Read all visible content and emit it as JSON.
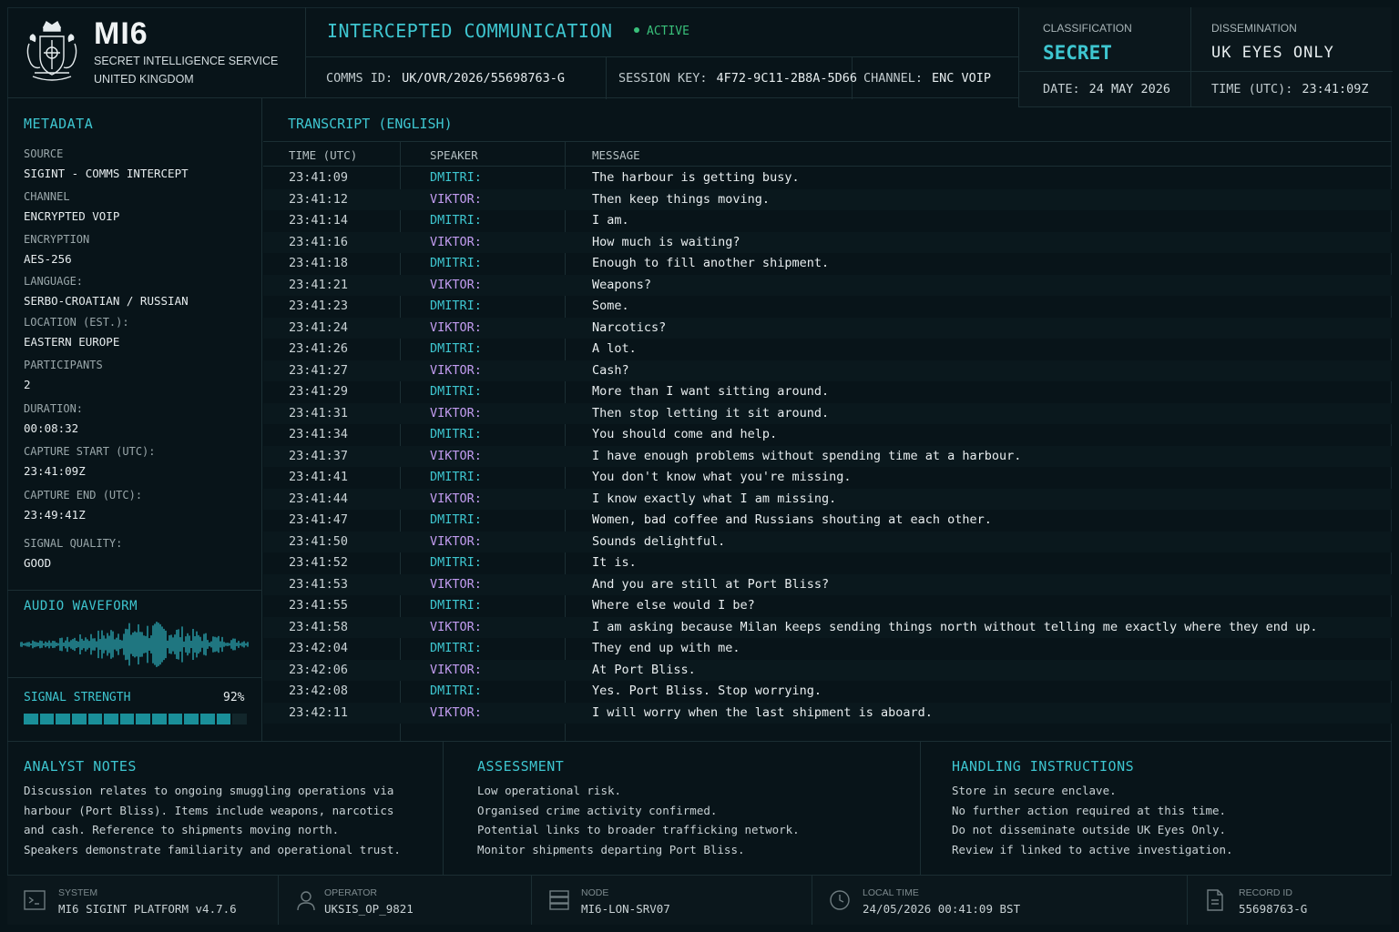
{
  "header": {
    "brand_title": "MI6",
    "brand_sub1": "SECRET INTELLIGENCE SERVICE",
    "brand_sub2": "UNITED KINGDOM",
    "comm_title": "INTERCEPTED COMMUNICATION",
    "status": "ACTIVE",
    "comms_id_label": "COMMS ID:",
    "comms_id": "UK/OVR/2026/55698763-G",
    "session_key_label": "SESSION KEY:",
    "session_key": "4F72-9C11-2B8A-5D66",
    "channel_label": "CHANNEL:",
    "channel": "ENC VOIP",
    "classification_label": "CLASSIFICATION",
    "classification": "SECRET",
    "dissemination_label": "DISSEMINATION",
    "dissemination": "UK EYES ONLY",
    "date_label": "DATE:",
    "date": "24 MAY 2026",
    "time_label": "TIME (UTC):",
    "time": "23:41:09Z"
  },
  "metadata": {
    "title": "METADATA",
    "items": [
      {
        "k": "SOURCE",
        "v": "SIGINT - COMMS INTERCEPT"
      },
      {
        "k": "CHANNEL",
        "v": "ENCRYPTED VOIP"
      },
      {
        "k": "ENCRYPTION",
        "v": "AES-256"
      },
      {
        "k": "LANGUAGE:",
        "v": "SERBO-CROATIAN / RUSSIAN"
      },
      {
        "k": "LOCATION (EST.):",
        "v": "EASTERN EUROPE"
      },
      {
        "k": "PARTICIPANTS",
        "v": "2"
      },
      {
        "k": "DURATION:",
        "v": "00:08:32"
      },
      {
        "k": "CAPTURE START (UTC):",
        "v": "23:41:09Z"
      },
      {
        "k": "CAPTURE END (UTC):",
        "v": "23:49:41Z"
      },
      {
        "k": "SIGNAL QUALITY:",
        "v": "GOOD"
      }
    ],
    "waveform_title": "AUDIO WAVEFORM",
    "signal_label": "SIGNAL STRENGTH",
    "signal_value": "92%",
    "signal_fraction": 0.92
  },
  "transcript": {
    "title": "TRANSCRIPT (ENGLISH)",
    "col_time": "TIME (UTC)",
    "col_speaker": "SPEAKER",
    "col_message": "MESSAGE",
    "rows": [
      {
        "t": "23:41:09",
        "s": "DMITRI:",
        "m": "The harbour is getting busy."
      },
      {
        "t": "23:41:12",
        "s": "VIKTOR:",
        "m": "Then keep things moving."
      },
      {
        "t": "23:41:14",
        "s": "DMITRI:",
        "m": "I am."
      },
      {
        "t": "23:41:16",
        "s": "VIKTOR:",
        "m": "How much is waiting?"
      },
      {
        "t": "23:41:18",
        "s": "DMITRI:",
        "m": "Enough to fill another shipment."
      },
      {
        "t": "23:41:21",
        "s": "VIKTOR:",
        "m": "Weapons?"
      },
      {
        "t": "23:41:23",
        "s": "DMITRI:",
        "m": "Some."
      },
      {
        "t": "23:41:24",
        "s": "VIKTOR:",
        "m": "Narcotics?"
      },
      {
        "t": "23:41:26",
        "s": "DMITRI:",
        "m": "A lot."
      },
      {
        "t": "23:41:27",
        "s": "VIKTOR:",
        "m": "Cash?"
      },
      {
        "t": "23:41:29",
        "s": "DMITRI:",
        "m": "More than I want sitting around."
      },
      {
        "t": "23:41:31",
        "s": "VIKTOR:",
        "m": "Then stop letting it sit around."
      },
      {
        "t": "23:41:34",
        "s": "DMITRI:",
        "m": "You should come and help."
      },
      {
        "t": "23:41:37",
        "s": "VIKTOR:",
        "m": "I have enough problems without spending time at a harbour."
      },
      {
        "t": "23:41:41",
        "s": "DMITRI:",
        "m": "You don't know what you're missing."
      },
      {
        "t": "23:41:44",
        "s": "VIKTOR:",
        "m": "I know exactly what I am missing."
      },
      {
        "t": "23:41:47",
        "s": "DMITRI:",
        "m": "Women, bad coffee and Russians shouting at each other."
      },
      {
        "t": "23:41:50",
        "s": "VIKTOR:",
        "m": "Sounds delightful."
      },
      {
        "t": "23:41:52",
        "s": "DMITRI:",
        "m": "It is."
      },
      {
        "t": "23:41:53",
        "s": "VIKTOR:",
        "m": "And you are still at Port Bliss?"
      },
      {
        "t": "23:41:55",
        "s": "DMITRI:",
        "m": "Where else would I be?"
      },
      {
        "t": "23:41:58",
        "s": "VIKTOR:",
        "m": "I am asking because Milan keeps sending things north without telling me exactly where they end up."
      },
      {
        "t": "23:42:04",
        "s": "DMITRI:",
        "m": "They end up with me."
      },
      {
        "t": "23:42:06",
        "s": "VIKTOR:",
        "m": "At Port Bliss."
      },
      {
        "t": "23:42:08",
        "s": "DMITRI:",
        "m": "Yes. Port Bliss. Stop worrying."
      },
      {
        "t": "23:42:11",
        "s": "VIKTOR:",
        "m": "I will worry when the last shipment is aboard."
      }
    ]
  },
  "notes": {
    "analyst_title": "ANALYST NOTES",
    "analyst_lines": [
      "Discussion relates to ongoing smuggling operations via",
      "harbour (Port Bliss). Items include weapons, narcotics",
      "and cash. Reference to shipments moving north.",
      "Speakers demonstrate familiarity and operational trust."
    ],
    "assessment_title": "ASSESSMENT",
    "assessment_lines": [
      "Low operational risk.",
      "Organised crime activity confirmed.",
      "Potential links to broader trafficking network.",
      "Monitor shipments departing Port Bliss."
    ],
    "handling_title": "HANDLING INSTRUCTIONS",
    "handling_lines": [
      "Store in secure enclave.",
      "No further action required at this time.",
      "Do not disseminate outside UK Eyes Only.",
      "Review if linked to active investigation."
    ]
  },
  "footer": {
    "system_label": "SYSTEM",
    "system": "MI6 SIGINT PLATFORM v4.7.6",
    "operator_label": "OPERATOR",
    "operator": "UKSIS_OP_9821",
    "node_label": "NODE",
    "node": "MI6-LON-SRV07",
    "local_time_label": "LOCAL TIME",
    "local_time": "24/05/2026 00:41:09 BST",
    "record_label": "RECORD ID",
    "record": "55698763-G"
  },
  "colors": {
    "accent": "#3ec6d0",
    "speaker_dmitri": "#3ec6d0",
    "speaker_viktor": "#c29cf0",
    "status_active": "#39c07a"
  }
}
